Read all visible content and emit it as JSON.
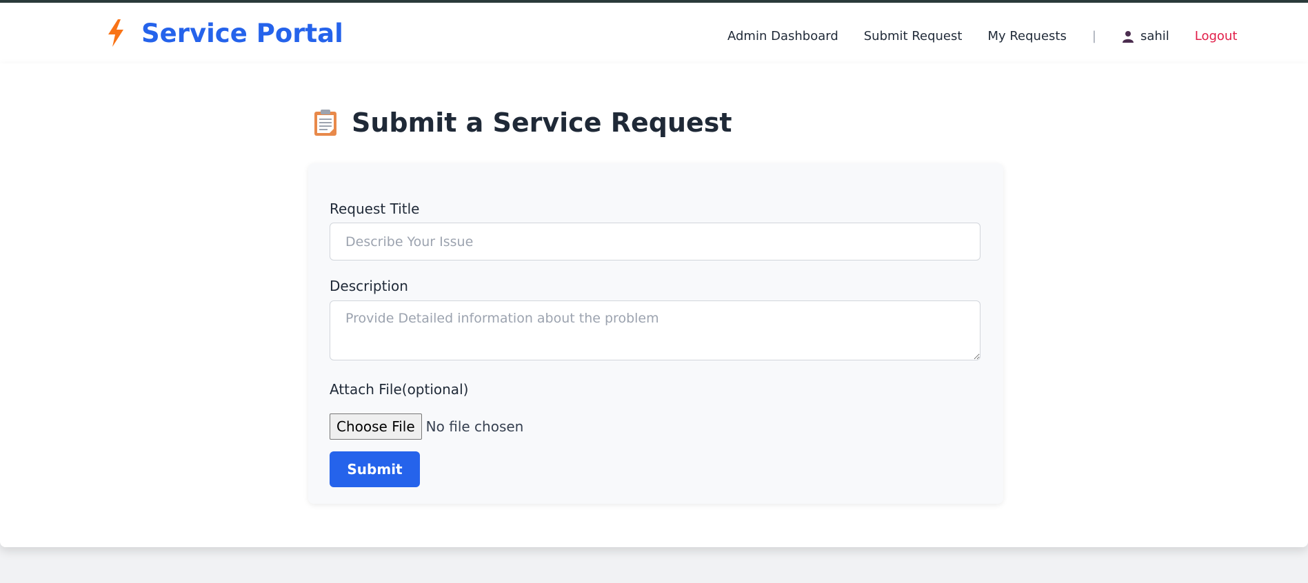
{
  "app": {
    "brand_name": "Service Portal",
    "brand_icon": "lightning-bolt-icon",
    "brand_color": "#2563eb",
    "accent_color": "#f97316"
  },
  "nav": {
    "admin_dashboard": "Admin Dashboard",
    "submit_request": "Submit Request",
    "my_requests": "My Requests",
    "separator": "|",
    "username": "sahil",
    "user_icon": "user-icon",
    "logout": "Logout",
    "logout_color": "#e11d48"
  },
  "page": {
    "title": "Submit a Service Request",
    "title_icon": "clipboard-icon"
  },
  "form": {
    "title_label": "Request Title",
    "title_placeholder": "Describe Your Issue",
    "title_value": "",
    "description_label": "Description",
    "description_placeholder": "Provide Detailed information about the problem",
    "description_value": "",
    "attach_label": "Attach File(optional)",
    "choose_file_label": "Choose File",
    "file_status": "No file chosen",
    "submit_label": "Submit",
    "submit_color": "#2563eb"
  }
}
